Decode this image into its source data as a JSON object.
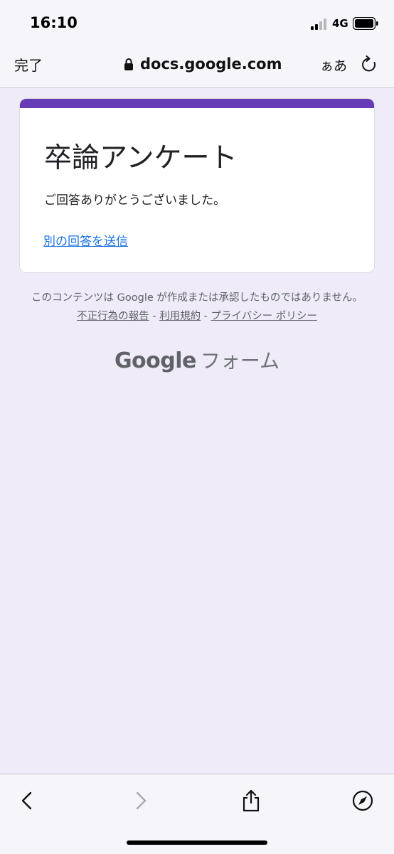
{
  "status_bar": {
    "time": "16:10",
    "network": "4G"
  },
  "browser": {
    "done_label": "完了",
    "url": "docs.google.com",
    "text_size_label": "ぁあ"
  },
  "form": {
    "title": "卒論アンケート",
    "confirmation": "ご回答ありがとうございました。",
    "another_response_link": "別の回答を送信",
    "accent_color": "#673ab7"
  },
  "footer": {
    "disclaimer_text": "このコンテンツは Google が作成または承認したものではありません。",
    "report_abuse": "不正行為の報告",
    "terms": "利用規約",
    "privacy": "プライバシー ポリシー",
    "separator": " - ",
    "brand_google": "Google",
    "brand_forms": "フォーム"
  },
  "toolbar": {
    "icons": [
      "back-icon",
      "forward-icon",
      "share-icon",
      "compass-icon"
    ]
  }
}
